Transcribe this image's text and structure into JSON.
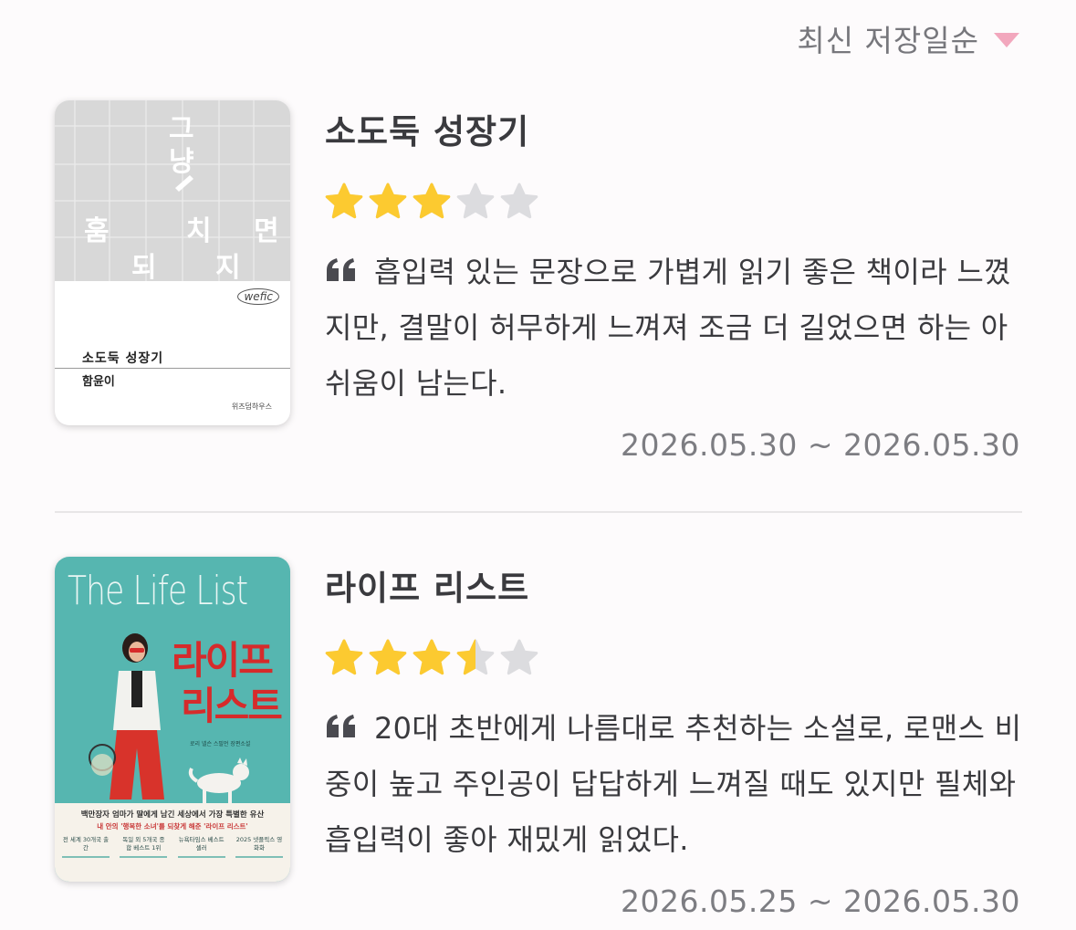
{
  "sort": {
    "label": "최신 저장일순",
    "caret_icon": "triangle-down-icon",
    "caret_color": "#f2a7bd"
  },
  "colors": {
    "star_filled": "#fcca30",
    "star_empty": "#dcdcdf",
    "text": "#3a3a3e",
    "muted": "#7d7d82"
  },
  "reviews": [
    {
      "title": "소도둑 성장기",
      "rating": 3,
      "rating_max": 5,
      "quote_icon": "quote-icon",
      "text": "흡입력 있는 문장으로 가볍게 읽기 좋은 책이라 느꼈지만, 결말이 허무하게 느껴져 조금 더 길었으면 하는 아쉬움이 남는다.",
      "date_range": "2026.05.30 ~ 2026.05.30",
      "cover": {
        "chars": [
          "그",
          "냥",
          "훔",
          "치",
          "면",
          "되",
          "지"
        ],
        "logo": "wefic",
        "title": "소도둑 성장기",
        "author": "함윤이",
        "publisher": "위즈덤하우스"
      }
    },
    {
      "title": "라이프 리스트",
      "rating": 3.5,
      "rating_max": 5,
      "quote_icon": "quote-icon",
      "text": "20대 초반에게 나름대로 추천하는 소설로, 로맨스 비중이 높고 주인공이 답답하게 느껴질 때도 있지만 필체와 흡입력이 좋아 재밌게 읽었다.",
      "date_range": "2026.05.25 ~ 2026.05.30",
      "cover": {
        "title_en": "The Life List",
        "title_kr_1": "라이프",
        "title_kr_2": "리스트",
        "small_text": "로리 넬슨 스필먼 장편소설",
        "band_line_1": "백만장자 엄마가 딸에게 남긴 세상에서 가장 특별한 유산",
        "band_line_2": "내 안의 '행복한 소녀'를 되찾게 해준 '라이프 리스트'",
        "badges": [
          "전 세계 30개국 출간",
          "독일 외 5개국 종합 베스트 1위",
          "뉴욕타임스 베스트셀러",
          "2025 넷플릭스 영화화"
        ]
      }
    }
  ]
}
